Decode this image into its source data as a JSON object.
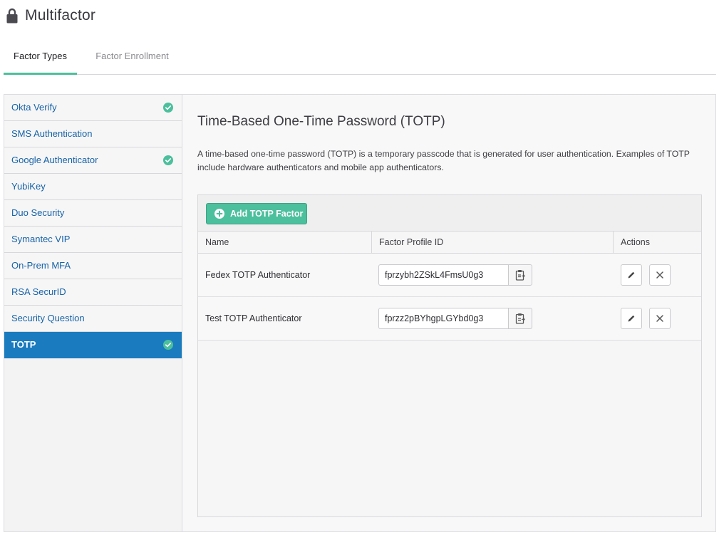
{
  "page": {
    "title": "Multifactor"
  },
  "tabs": [
    {
      "label": "Factor Types",
      "active": true
    },
    {
      "label": "Factor Enrollment",
      "active": false
    }
  ],
  "sidebar": {
    "items": [
      {
        "label": "Okta Verify",
        "checked": true
      },
      {
        "label": "SMS Authentication",
        "checked": false
      },
      {
        "label": "Google Authenticator",
        "checked": true
      },
      {
        "label": "YubiKey",
        "checked": false
      },
      {
        "label": "Duo Security",
        "checked": false
      },
      {
        "label": "Symantec VIP",
        "checked": false
      },
      {
        "label": "On-Prem MFA",
        "checked": false
      },
      {
        "label": "RSA SecurID",
        "checked": false
      },
      {
        "label": "Security Question",
        "checked": false
      },
      {
        "label": "TOTP",
        "checked": true,
        "active": true
      }
    ]
  },
  "factor": {
    "title": "Time-Based One-Time Password (TOTP)",
    "description": "A time-based one-time password (TOTP) is a temporary passcode that is generated for user authentication. Examples of TOTP include hardware authenticators and mobile app authenticators.",
    "add_button_label": "Add TOTP Factor"
  },
  "table": {
    "columns": [
      "Name",
      "Factor Profile ID",
      "Actions"
    ],
    "rows": [
      {
        "name": "Fedex TOTP Authenticator",
        "profile_id": "fprzybh2ZSkL4FmsU0g3"
      },
      {
        "name": "Test TOTP Authenticator",
        "profile_id": "fprzz2pBYhgpLGYbd0g3"
      }
    ]
  },
  "colors": {
    "accent_green": "#4cbf9c",
    "active_blue": "#1a7bbf",
    "link_blue": "#1662a8"
  },
  "icons": {
    "title": "lock-icon",
    "check": "check-circle-icon",
    "add": "plus-circle-icon",
    "copy": "clipboard-icon",
    "edit": "pencil-icon",
    "delete": "close-icon"
  }
}
